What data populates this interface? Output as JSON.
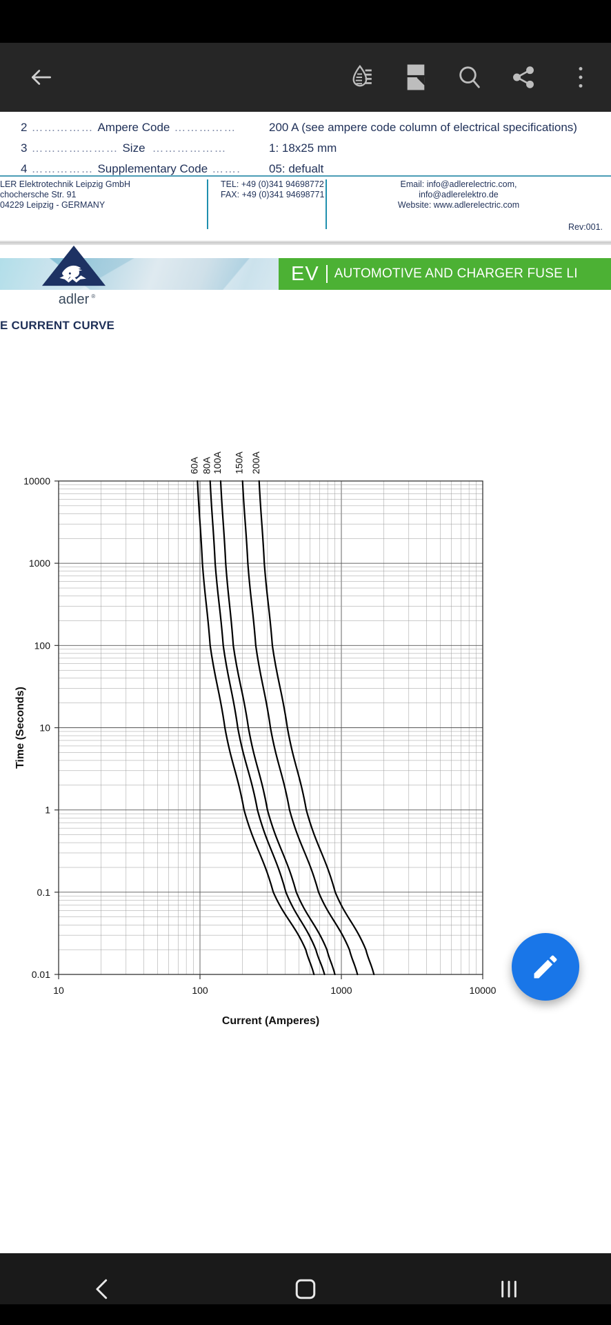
{
  "app": {
    "toolbar": {
      "back_label": "Back",
      "icons": [
        {
          "name": "brightness-icon",
          "label": "Brightness"
        },
        {
          "name": "page-fit-icon",
          "label": "Page view"
        },
        {
          "name": "search-icon",
          "label": "Search"
        },
        {
          "name": "share-icon",
          "label": "Share"
        },
        {
          "name": "overflow-menu-icon",
          "label": "More options"
        }
      ]
    },
    "fab": {
      "name": "edit-fab",
      "label": "Edit"
    },
    "navbar": {
      "back": "Back",
      "home": "Home",
      "recents": "Recent apps"
    }
  },
  "document": {
    "code_list": [
      {
        "num": "2",
        "dots_left": "……………",
        "name": "Ampere Code",
        "dots_right": "……………",
        "value": "200 A (see ampere code column of electrical specifications)"
      },
      {
        "num": "3",
        "dots_left": "…………………",
        "name": "Size",
        "dots_right": "………………",
        "value": "1: 18x25 mm"
      },
      {
        "num": "4",
        "dots_left": "……………",
        "name": "Supplementary Code",
        "dots_right": "…….",
        "value": "05: defualt"
      }
    ],
    "contact": {
      "company_lines": [
        "LER Elektrotechnik Leipzig GmbH",
        "chochersche Str. 91",
        "04229 Leipzig - GERMANY"
      ],
      "phone_lines": [
        "TEL: +49 (0)341 94698772",
        "FAX: +49 (0)341 94698771"
      ],
      "web_lines": [
        "Email: info@adlerelectric.com,",
        "info@adlerelektro.de",
        "Website: www.adlerelectric.com"
      ],
      "revision": "Rev:001."
    },
    "banner": {
      "brand": "adler",
      "brand_mark": "®",
      "ev": "EV",
      "subtitle": "AUTOMOTIVE AND CHARGER FUSE LI"
    },
    "section_title": "E CURRENT CURVE"
  },
  "chart_data": {
    "type": "line",
    "title": "E CURRENT CURVE",
    "xlabel": "Current (Amperes)",
    "ylabel": "Time (Seconds)",
    "xscale": "log",
    "yscale": "log",
    "xlim": [
      10,
      10000
    ],
    "ylim": [
      0.01,
      10000
    ],
    "xticklabels": [
      "10",
      "100",
      "1000",
      "10000"
    ],
    "yticklabels": [
      "0.01",
      "0.1",
      "1",
      "10",
      "100",
      "1000",
      "10000"
    ],
    "grid": true,
    "legend": "inline-curve-labels",
    "series": [
      {
        "name": "60A",
        "label": "60A",
        "points": [
          [
            96,
            10000
          ],
          [
            104,
            1000
          ],
          [
            118,
            100
          ],
          [
            150,
            10
          ],
          [
            205,
            1
          ],
          [
            330,
            0.1
          ],
          [
            560,
            0.02
          ],
          [
            640,
            0.01
          ]
        ]
      },
      {
        "name": "80A",
        "label": "80A",
        "points": [
          [
            118,
            10000
          ],
          [
            128,
            1000
          ],
          [
            146,
            100
          ],
          [
            185,
            10
          ],
          [
            255,
            1
          ],
          [
            405,
            0.1
          ],
          [
            660,
            0.02
          ],
          [
            760,
            0.01
          ]
        ]
      },
      {
        "name": "100A",
        "label": "100A",
        "points": [
          [
            140,
            10000
          ],
          [
            152,
            1000
          ],
          [
            172,
            100
          ],
          [
            220,
            10
          ],
          [
            300,
            1
          ],
          [
            480,
            0.1
          ],
          [
            790,
            0.02
          ],
          [
            900,
            0.01
          ]
        ]
      },
      {
        "name": "150A",
        "label": "150A",
        "points": [
          [
            200,
            10000
          ],
          [
            218,
            1000
          ],
          [
            248,
            100
          ],
          [
            315,
            10
          ],
          [
            430,
            1
          ],
          [
            690,
            0.1
          ],
          [
            1140,
            0.02
          ],
          [
            1300,
            0.01
          ]
        ]
      },
      {
        "name": "200A",
        "label": "200A",
        "points": [
          [
            262,
            10000
          ],
          [
            285,
            1000
          ],
          [
            325,
            100
          ],
          [
            415,
            10
          ],
          [
            565,
            1
          ],
          [
            905,
            0.1
          ],
          [
            1490,
            0.02
          ],
          [
            1700,
            0.01
          ]
        ]
      }
    ]
  },
  "colors": {
    "toolbar_bg": "#262626",
    "banner_green": "#4cb134",
    "doc_text": "#1f3058",
    "fab_blue": "#1976e8",
    "rule_teal": "#1f8fae"
  }
}
